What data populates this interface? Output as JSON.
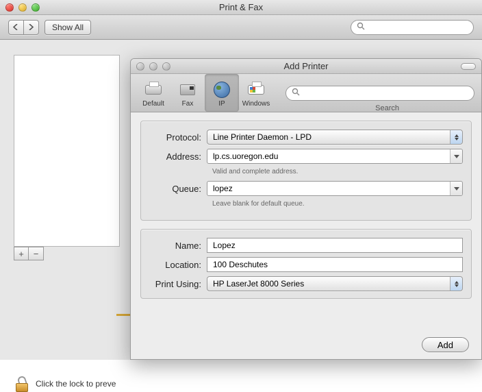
{
  "main": {
    "title": "Print & Fax",
    "show_all": "Show All",
    "lock_text": "Click the lock to preve"
  },
  "add": {
    "title": "Add Printer",
    "toolbar": {
      "default": "Default",
      "fax": "Fax",
      "ip": "IP",
      "windows": "Windows",
      "search_label": "Search"
    },
    "panel1": {
      "protocol_label": "Protocol:",
      "protocol_value": "Line Printer Daemon - LPD",
      "address_label": "Address:",
      "address_value": "lp.cs.uoregon.edu",
      "address_hint": "Valid and complete address.",
      "queue_label": "Queue:",
      "queue_value": "lopez",
      "queue_hint": "Leave blank for default queue."
    },
    "panel2": {
      "name_label": "Name:",
      "name_value": "Lopez",
      "location_label": "Location:",
      "location_value": "100 Deschutes",
      "printusing_label": "Print Using:",
      "printusing_value": "HP LaserJet 8000 Series"
    },
    "add_button": "Add"
  }
}
